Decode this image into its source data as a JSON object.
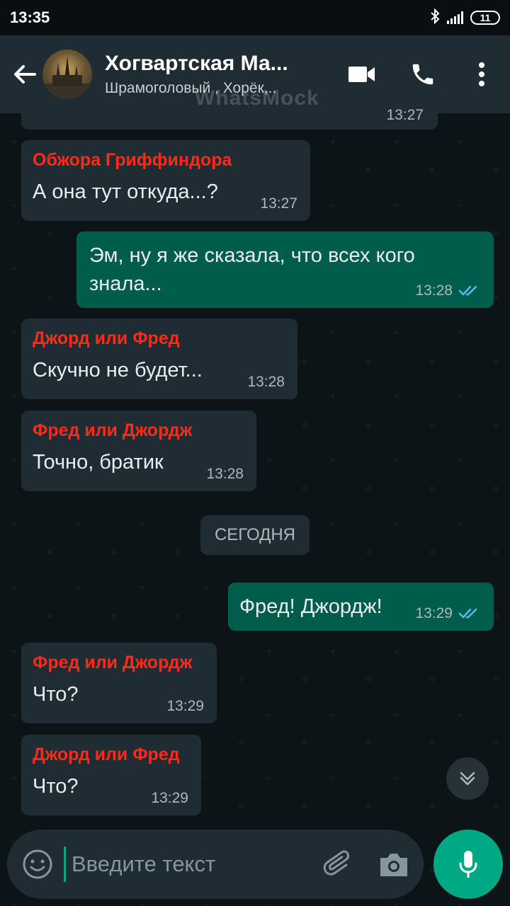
{
  "status_bar": {
    "time": "13:35",
    "battery": "11"
  },
  "header": {
    "title": "Хогвартская Ма...",
    "members": "Шрамоголовый , Хорёк,..",
    "watermark": "WhatsMock"
  },
  "messages": [
    {
      "direction": "incoming",
      "sender": "Обжора Гриффиндора",
      "text": "А она тут откуда...?",
      "time": "13:27"
    },
    {
      "direction": "outgoing",
      "text": "Эм, ну я же сказала, что всех кого знала...",
      "time": "13:28",
      "status": "read"
    },
    {
      "direction": "incoming",
      "sender": "Джорд или Фред",
      "text": "Скучно не будет...",
      "time": "13:28"
    },
    {
      "direction": "incoming",
      "sender": "Фред или Джордж",
      "text": "Точно, братик",
      "time": "13:28"
    },
    {
      "direction": "outgoing",
      "text": "Фред! Джордж!",
      "time": "13:29",
      "status": "read"
    },
    {
      "direction": "incoming",
      "sender": "Фред или Джордж",
      "text": "Что?",
      "time": "13:29"
    },
    {
      "direction": "incoming",
      "sender": "Джорд или Фред",
      "text": "Что?",
      "time": "13:29"
    }
  ],
  "date_divider": "СЕГОДНЯ",
  "partial_message_time": "13:27",
  "input": {
    "placeholder": "Введите текст"
  },
  "colors": {
    "header_bg": "#1f2c33",
    "incoming_bubble": "#1f2c33",
    "outgoing_bubble": "#005c4b",
    "sender_name": "#ff2a18",
    "accent": "#00a884",
    "read_ticks": "#53bdeb"
  },
  "icons": {
    "back": "arrow-left-icon",
    "video": "video-camera-icon",
    "call": "phone-icon",
    "menu": "more-vertical-icon",
    "emoji": "emoji-icon",
    "attach": "paperclip-icon",
    "camera": "camera-icon",
    "mic": "microphone-icon",
    "scroll": "chevron-double-down-icon"
  }
}
